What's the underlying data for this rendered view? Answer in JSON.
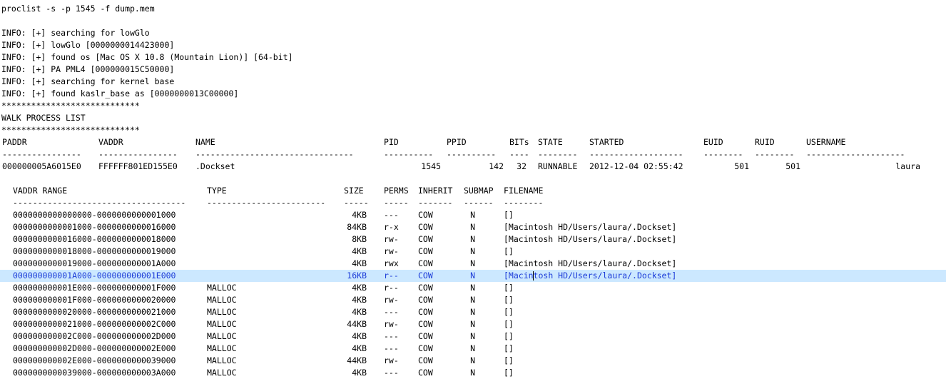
{
  "command": "proclist -s -p 1545 -f dump.mem",
  "info_lines": [
    "INFO: [+] searching for lowGlo",
    "INFO: [+] lowGlo [0000000014423000]",
    "INFO: [+] found os [Mac OS X 10.8 (Mountain Lion)] [64-bit]",
    "INFO: [+] PA PML4 [000000015C50000]",
    "INFO: [+] searching for kernel base",
    "INFO: [+] found kaslr_base as [0000000013C00000]"
  ],
  "banner": {
    "stars": "****************************",
    "title": "WALK PROCESS LIST"
  },
  "process_table": {
    "headers": {
      "paddr": "PADDR",
      "vaddr": "VADDR",
      "name": "NAME",
      "pid": "PID",
      "ppid": "PPID",
      "bits": "BITs",
      "state": "STATE",
      "started": "STARTED",
      "euid": "EUID",
      "ruid": "RUID",
      "username": "USERNAME"
    },
    "dashes": {
      "paddr": "----------------",
      "vaddr": "----------------",
      "name": "--------------------------------",
      "pid": "----------",
      "ppid": "----------",
      "bits": "----",
      "state": "--------",
      "started": "-------------------",
      "euid": "--------",
      "ruid": "--------",
      "username": "--------------------"
    },
    "row": {
      "paddr": "000000005A6015E0",
      "vaddr": "FFFFFF801ED155E0",
      "name": ".Dockset",
      "pid": "1545",
      "ppid": "142",
      "bits": "32",
      "state": "RUNNABLE",
      "started": "2012-12-04 02:55:42",
      "euid": "501",
      "ruid": "501",
      "username": "laura"
    }
  },
  "map_table": {
    "headers": {
      "range": "VADDR RANGE",
      "type": "TYPE",
      "size": "SIZE",
      "perms": "PERMS",
      "inherit": "INHERIT",
      "submap": "SUBMAP",
      "filename": "FILENAME"
    },
    "dashes": {
      "range": "-----------------------------------",
      "type": "------------------------",
      "size": "-----",
      "perms": "-----",
      "inherit": "-------",
      "submap": "------",
      "filename": "--------"
    },
    "rows": [
      {
        "range": "0000000000000000-0000000000001000",
        "type": "",
        "size": "4KB",
        "perms": "---",
        "inherit": "COW",
        "submap": "N",
        "filename": "[]"
      },
      {
        "range": "0000000000001000-0000000000016000",
        "type": "",
        "size": "84KB",
        "perms": "r-x",
        "inherit": "COW",
        "submap": "N",
        "filename": "[Macintosh HD/Users/laura/.Dockset]"
      },
      {
        "range": "0000000000016000-0000000000018000",
        "type": "",
        "size": "8KB",
        "perms": "rw-",
        "inherit": "COW",
        "submap": "N",
        "filename": "[Macintosh HD/Users/laura/.Dockset]"
      },
      {
        "range": "0000000000018000-0000000000019000",
        "type": "",
        "size": "4KB",
        "perms": "rw-",
        "inherit": "COW",
        "submap": "N",
        "filename": "[]"
      },
      {
        "range": "0000000000019000-000000000001A000",
        "type": "",
        "size": "4KB",
        "perms": "rwx",
        "inherit": "COW",
        "submap": "N",
        "filename": "[Macintosh HD/Users/laura/.Dockset]"
      },
      {
        "range": "000000000001A000-000000000001E000",
        "type": "",
        "size": "16KB",
        "perms": "r--",
        "inherit": "COW",
        "submap": "N",
        "filename": "[Macintosh HD/Users/laura/.Dockset]"
      },
      {
        "range": "000000000001E000-000000000001F000",
        "type": "MALLOC",
        "size": "4KB",
        "perms": "r--",
        "inherit": "COW",
        "submap": "N",
        "filename": "[]"
      },
      {
        "range": "000000000001F000-0000000000020000",
        "type": "MALLOC",
        "size": "4KB",
        "perms": "rw-",
        "inherit": "COW",
        "submap": "N",
        "filename": "[]"
      },
      {
        "range": "0000000000020000-0000000000021000",
        "type": "MALLOC",
        "size": "4KB",
        "perms": "---",
        "inherit": "COW",
        "submap": "N",
        "filename": "[]"
      },
      {
        "range": "0000000000021000-000000000002C000",
        "type": "MALLOC",
        "size": "44KB",
        "perms": "rw-",
        "inherit": "COW",
        "submap": "N",
        "filename": "[]"
      },
      {
        "range": "000000000002C000-000000000002D000",
        "type": "MALLOC",
        "size": "4KB",
        "perms": "---",
        "inherit": "COW",
        "submap": "N",
        "filename": "[]"
      },
      {
        "range": "000000000002D000-000000000002E000",
        "type": "MALLOC",
        "size": "4KB",
        "perms": "---",
        "inherit": "COW",
        "submap": "N",
        "filename": "[]"
      },
      {
        "range": "000000000002E000-0000000000039000",
        "type": "MALLOC",
        "size": "44KB",
        "perms": "rw-",
        "inherit": "COW",
        "submap": "N",
        "filename": "[]"
      },
      {
        "range": "0000000000039000-000000000003A000",
        "type": "MALLOC",
        "size": "4KB",
        "perms": "---",
        "inherit": "COW",
        "submap": "N",
        "filename": "[]"
      }
    ],
    "selected_row": 5
  },
  "colors": {
    "selection_bg": "#cce8ff",
    "selection_fg": "#1a3ad8"
  }
}
